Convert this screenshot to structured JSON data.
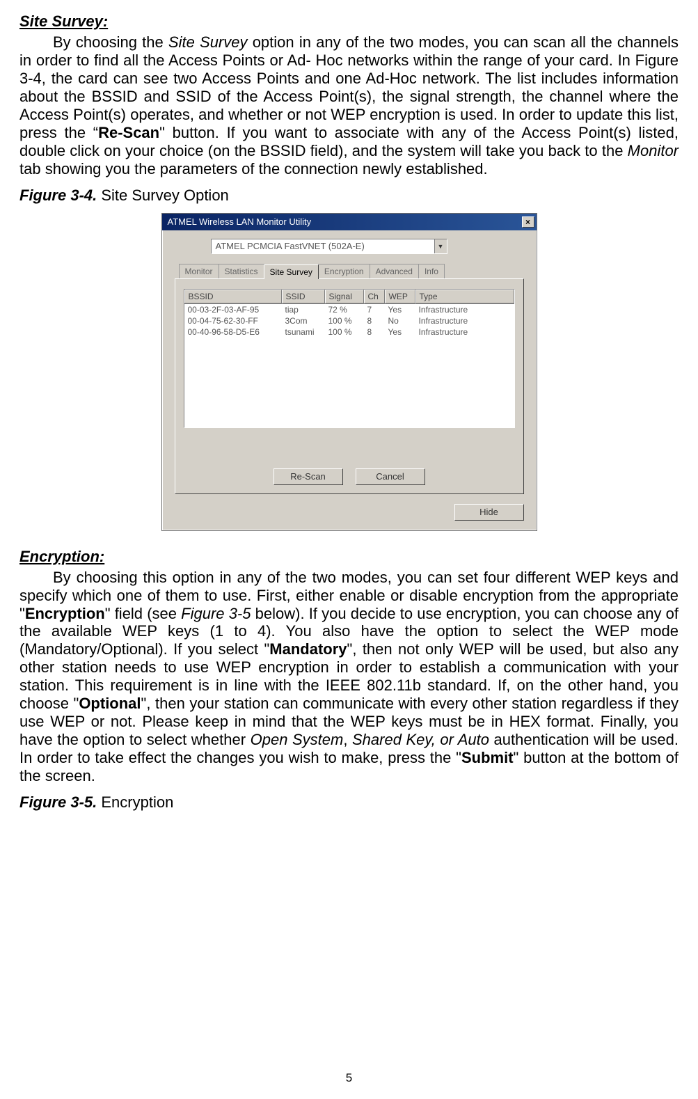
{
  "section1": {
    "heading": "Site Survey:",
    "para": "By choosing the Site Survey option in any of the two modes, you can scan all the channels in order to find all the Access Points or Ad- Hoc networks within the range of your card. In Figure 3-4, the card can see two Access Points and one Ad-Hoc network. The list includes information about the BSSID and SSID of the Access Point(s), the signal strength, the channel where the Access Point(s) operates, and whether or not WEP encryption is used. In order to update this list, press the \"",
    "rescan": "Re-Scan",
    "para_mid": "\" button. If you want to associate with any of the Access Point(s) listed, double click on your choice (on the BSSID field), and the system will take you back to the ",
    "monitor": "Monitor",
    "para_end": " tab showing you the parameters of the connection newly established."
  },
  "fig34": {
    "label": "Figure 3-4.",
    "text": " Site Survey Option"
  },
  "window": {
    "title": "ATMEL Wireless LAN Monitor Utility",
    "close": "×",
    "combo": "ATMEL PCMCIA FastVNET (502A-E)",
    "tabs": [
      "Monitor",
      "Statistics",
      "Site Survey",
      "Encryption",
      "Advanced",
      "Info"
    ],
    "cols": {
      "bssid": "BSSID",
      "ssid": "SSID",
      "signal": "Signal",
      "ch": "Ch",
      "wep": "WEP",
      "type": "Type"
    },
    "rows": [
      {
        "bssid": "00-03-2F-03-AF-95",
        "ssid": "tiap",
        "signal": "72 %",
        "ch": "7",
        "wep": "Yes",
        "type": "Infrastructure"
      },
      {
        "bssid": "00-04-75-62-30-FF",
        "ssid": "3Com",
        "signal": "100 %",
        "ch": "8",
        "wep": "No",
        "type": "Infrastructure"
      },
      {
        "bssid": "00-40-96-58-D5-E6",
        "ssid": "tsunami",
        "signal": "100 %",
        "ch": "8",
        "wep": "Yes",
        "type": "Infrastructure"
      }
    ],
    "btn_rescan": "Re-Scan",
    "btn_cancel": "Cancel",
    "btn_hide": "Hide"
  },
  "section2": {
    "heading": "Encryption:",
    "p1": "By choosing this option in any of the two modes, you can set four different WEP keys and specify which one of them to use. First, either enable or disable encryption from the appropriate \"",
    "encryption": "Encryption",
    "p2": "\" field (see ",
    "figref": "Figure 3-5",
    "p3": " below). If you decide to use encryption, you can choose any of the available WEP keys (1 to 4). You also have the option to select the WEP mode (Mandatory/Optional). If you select \"",
    "mandatory": "Mandatory",
    "p4": "\", then not only WEP will be used, but also any other station needs to use WEP encryption in order to establish a communication with your station. This requirement is in line with the IEEE 802.11b standard. If, on the other hand, you choose \"",
    "optional": "Optional",
    "p5": "\", then your station can communicate with every other station regardless if they use WEP or not. Please keep in mind that the WEP keys must be in HEX format. Finally, you have the option to select whether ",
    "opensys": "Open System",
    "p6": ", ",
    "shared": "Shared Key, or Auto",
    "p7": " authentication will be used. In order to take effect the changes you wish to make, press the \"",
    "submit": "Submit",
    "p8": "\" button at the bottom of the screen."
  },
  "fig35": {
    "label": "Figure 3-5.",
    "text": " Encryption"
  },
  "pagenum": "5"
}
